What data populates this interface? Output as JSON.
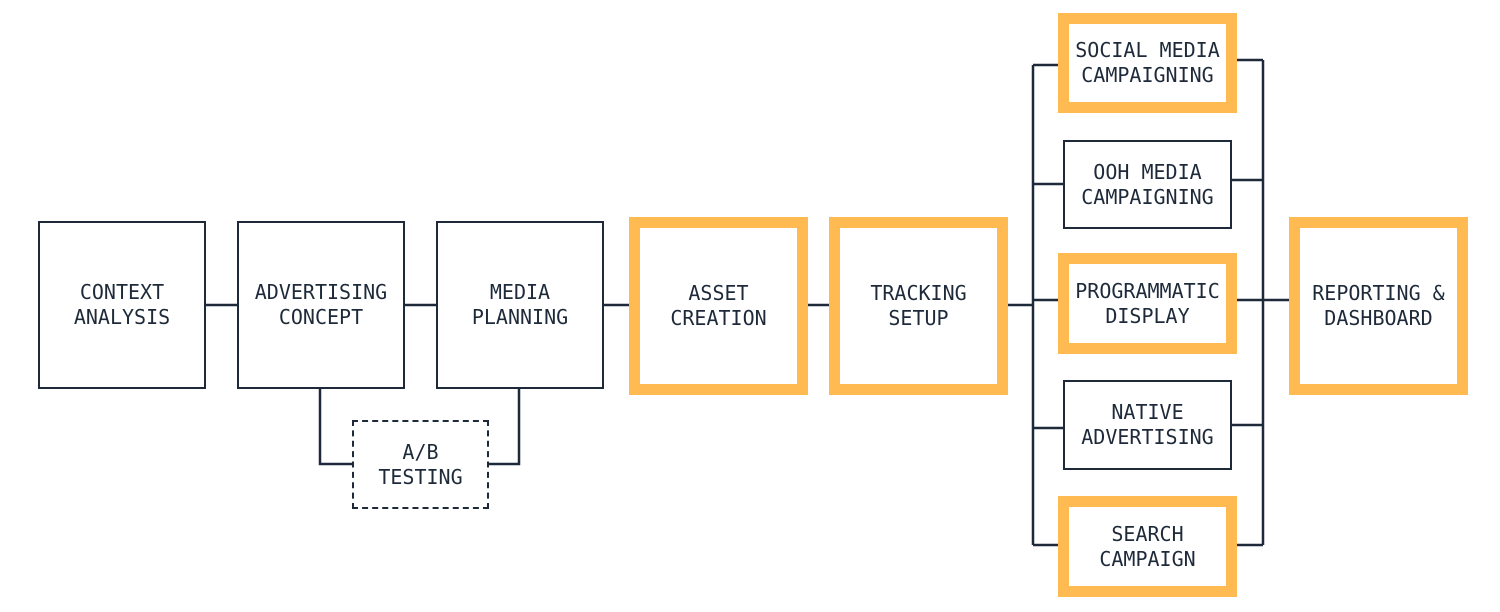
{
  "colors": {
    "stroke": "#1e2a3a",
    "highlight": "#ffba52"
  },
  "nodes": {
    "context": "CONTEXT\nANALYSIS",
    "advertising": "ADVERTISING\nCONCEPT",
    "media": "MEDIA\nPLANNING",
    "ab": "A/B\nTESTING",
    "asset": "ASSET\nCREATION",
    "tracking": "TRACKING\nSETUP",
    "social": "SOCIAL MEDIA\nCAMPAIGNING",
    "ooh": "OOH MEDIA\nCAMPAIGNING",
    "programmatic": "PROGRAMMATIC\nDISPLAY",
    "native": "NATIVE\nADVERTISING",
    "search": "SEARCH\nCAMPAIGN",
    "reporting": "REPORTING &\nDASHBOARD"
  },
  "highlighted": [
    "asset",
    "tracking",
    "social",
    "programmatic",
    "search",
    "reporting"
  ],
  "optional": [
    "ab"
  ]
}
